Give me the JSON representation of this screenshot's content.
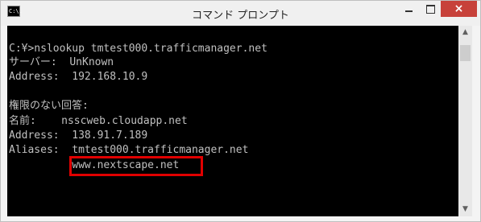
{
  "window": {
    "title": "コマンド プロンプト",
    "icon_text": "C:\\.",
    "icon": "console-icon",
    "close_label": "×"
  },
  "console": {
    "lines": [
      "",
      "C:¥>nslookup tmtest000.trafficmanager.net",
      "サーバー:  UnKnown",
      "Address:  192.168.10.9",
      "",
      "権限のない回答:",
      "名前:    nsscweb.cloudapp.net",
      "Address:  138.91.7.189",
      "Aliases:  tmtest000.trafficmanager.net",
      "          www.nextscape.net"
    ]
  },
  "scrollbar": {
    "up_glyph": "▲",
    "down_glyph": "▼"
  },
  "colors": {
    "console_bg": "#000000",
    "console_text": "#c0c0c0",
    "highlight": "#e10000",
    "close_button": "#c7413a"
  }
}
